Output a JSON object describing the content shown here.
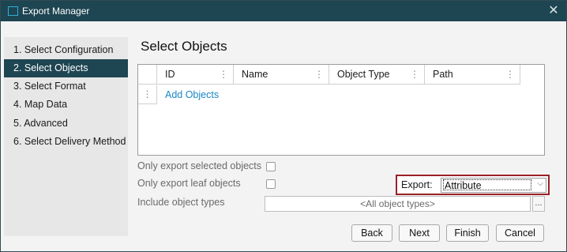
{
  "window": {
    "title": "Export Manager",
    "close_icon": "close-icon"
  },
  "steps": [
    {
      "label": "1. Select Configuration",
      "active": false
    },
    {
      "label": "2. Select Objects",
      "active": true
    },
    {
      "label": "3. Select Format",
      "active": false
    },
    {
      "label": "4. Map Data",
      "active": false
    },
    {
      "label": "5. Advanced",
      "active": false
    },
    {
      "label": "6. Select Delivery Method",
      "active": false
    }
  ],
  "main": {
    "title": "Select Objects",
    "columns": [
      "ID",
      "Name",
      "Object Type",
      "Path"
    ],
    "column_menu_glyph": "⋮",
    "add_objects_label": "Add Objects",
    "options": {
      "only_selected_label": "Only export selected objects",
      "only_selected_checked": false,
      "only_leaf_label": "Only export leaf objects",
      "only_leaf_checked": false,
      "include_types_label": "Include object types",
      "include_types_value": "<All object types>",
      "browse_label": "..."
    },
    "export": {
      "label": "Export:",
      "value": "Attribute"
    }
  },
  "footer": {
    "back": "Back",
    "next": "Next",
    "finish": "Finish",
    "cancel": "Cancel"
  },
  "colors": {
    "titlebar": "#1e4552",
    "active_step": "#1e4552",
    "link": "#1b86c5",
    "highlight_border": "#9b2027"
  }
}
